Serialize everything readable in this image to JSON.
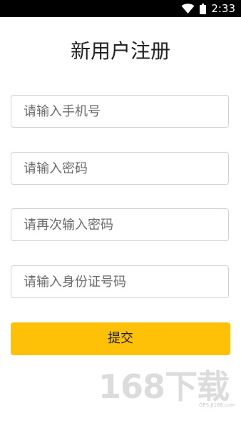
{
  "status_bar": {
    "time": "2:33",
    "wifi_icon": "wifi-icon",
    "battery_icon": "battery-icon"
  },
  "page": {
    "title": "新用户注册"
  },
  "form": {
    "phone_placeholder": "请输入手机号",
    "password_placeholder": "请输入密码",
    "confirm_password_placeholder": "请再次输入密码",
    "id_number_placeholder": "请输入身份证号码",
    "submit_label": "提交"
  },
  "watermark": {
    "logo_text": "168下载",
    "url": "GPS.JI168.com"
  },
  "colors": {
    "accent": "#ffc107",
    "status_bar": "#000000",
    "border": "#d2d2d2"
  }
}
